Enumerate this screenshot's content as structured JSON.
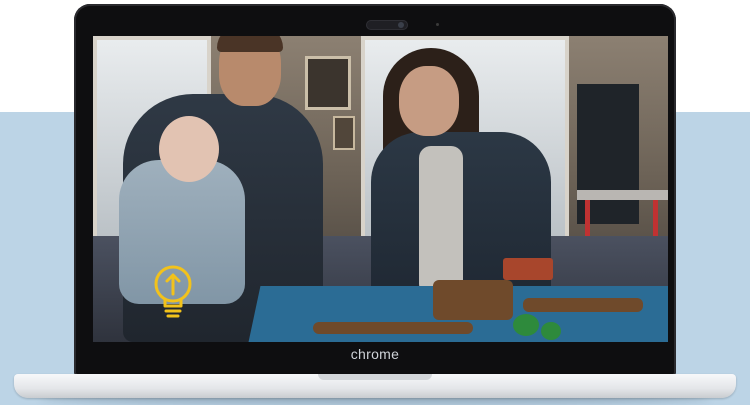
{
  "scene": {
    "brand_label": "chrome"
  },
  "overlay": {
    "icon": "lightbulb-upload-icon",
    "icon_color": "#f2c21b"
  },
  "colors": {
    "background_band": "#bcd4e6",
    "laptop_bezel": "#0e0e10",
    "laptop_base": "#eef0f2"
  }
}
